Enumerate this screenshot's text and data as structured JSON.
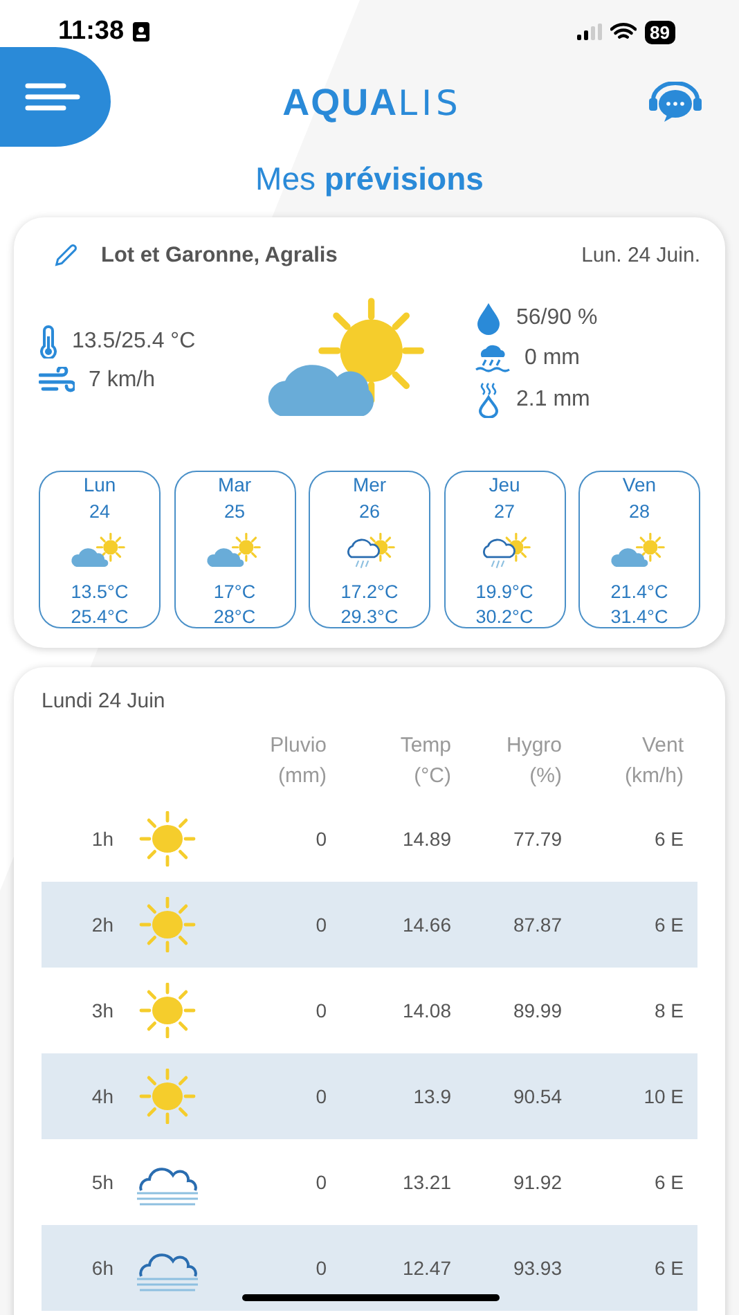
{
  "status_bar": {
    "time": "11:38",
    "battery": "89"
  },
  "header": {
    "logo_bold": "AQUA",
    "logo_light": "LIS"
  },
  "title_light": "Mes",
  "title_bold": "prévisions",
  "today": {
    "location": "Lot et Garonne, Agralis",
    "date": "Lun. 24 Juin.",
    "temperature": "13.5/25.4 °C",
    "wind": "7 km/h",
    "humidity": "56/90  %",
    "rain": "0  mm",
    "evapotranspiration": "2.1  mm",
    "kind": "cloud-sun"
  },
  "days": [
    {
      "day": "Lun",
      "date": "24",
      "kind": "cloud-sun",
      "min": "13.5°C",
      "max": "25.4°C"
    },
    {
      "day": "Mar",
      "date": "25",
      "kind": "cloud-sun",
      "min": "17°C",
      "max": "28°C"
    },
    {
      "day": "Mer",
      "date": "26",
      "kind": "rain-sun",
      "min": "17.2°C",
      "max": "29.3°C"
    },
    {
      "day": "Jeu",
      "date": "27",
      "kind": "rain-sun",
      "min": "19.9°C",
      "max": "30.2°C"
    },
    {
      "day": "Ven",
      "date": "28",
      "kind": "cloud-sun",
      "min": "21.4°C",
      "max": "31.4°C"
    }
  ],
  "hourly": {
    "title": "Lundi 24 Juin",
    "columns": [
      {
        "name": "Pluvio",
        "unit": "(mm)"
      },
      {
        "name": "Temp",
        "unit": "(°C)"
      },
      {
        "name": "Hygro",
        "unit": "(%)"
      },
      {
        "name": "Vent",
        "unit": "(km/h)"
      }
    ],
    "rows": [
      {
        "hour": "1h",
        "kind": "sun",
        "rain": "0",
        "temp": "14.89",
        "hygro": "77.79",
        "wind": "6 E"
      },
      {
        "hour": "2h",
        "kind": "sun",
        "rain": "0",
        "temp": "14.66",
        "hygro": "87.87",
        "wind": "6 E"
      },
      {
        "hour": "3h",
        "kind": "sun",
        "rain": "0",
        "temp": "14.08",
        "hygro": "89.99",
        "wind": "8 E"
      },
      {
        "hour": "4h",
        "kind": "sun",
        "rain": "0",
        "temp": "13.9",
        "hygro": "90.54",
        "wind": "10 E"
      },
      {
        "hour": "5h",
        "kind": "fog",
        "rain": "0",
        "temp": "13.21",
        "hygro": "91.92",
        "wind": "6 E"
      },
      {
        "hour": "6h",
        "kind": "fog",
        "rain": "0",
        "temp": "12.47",
        "hygro": "93.93",
        "wind": "6 E"
      }
    ]
  }
}
